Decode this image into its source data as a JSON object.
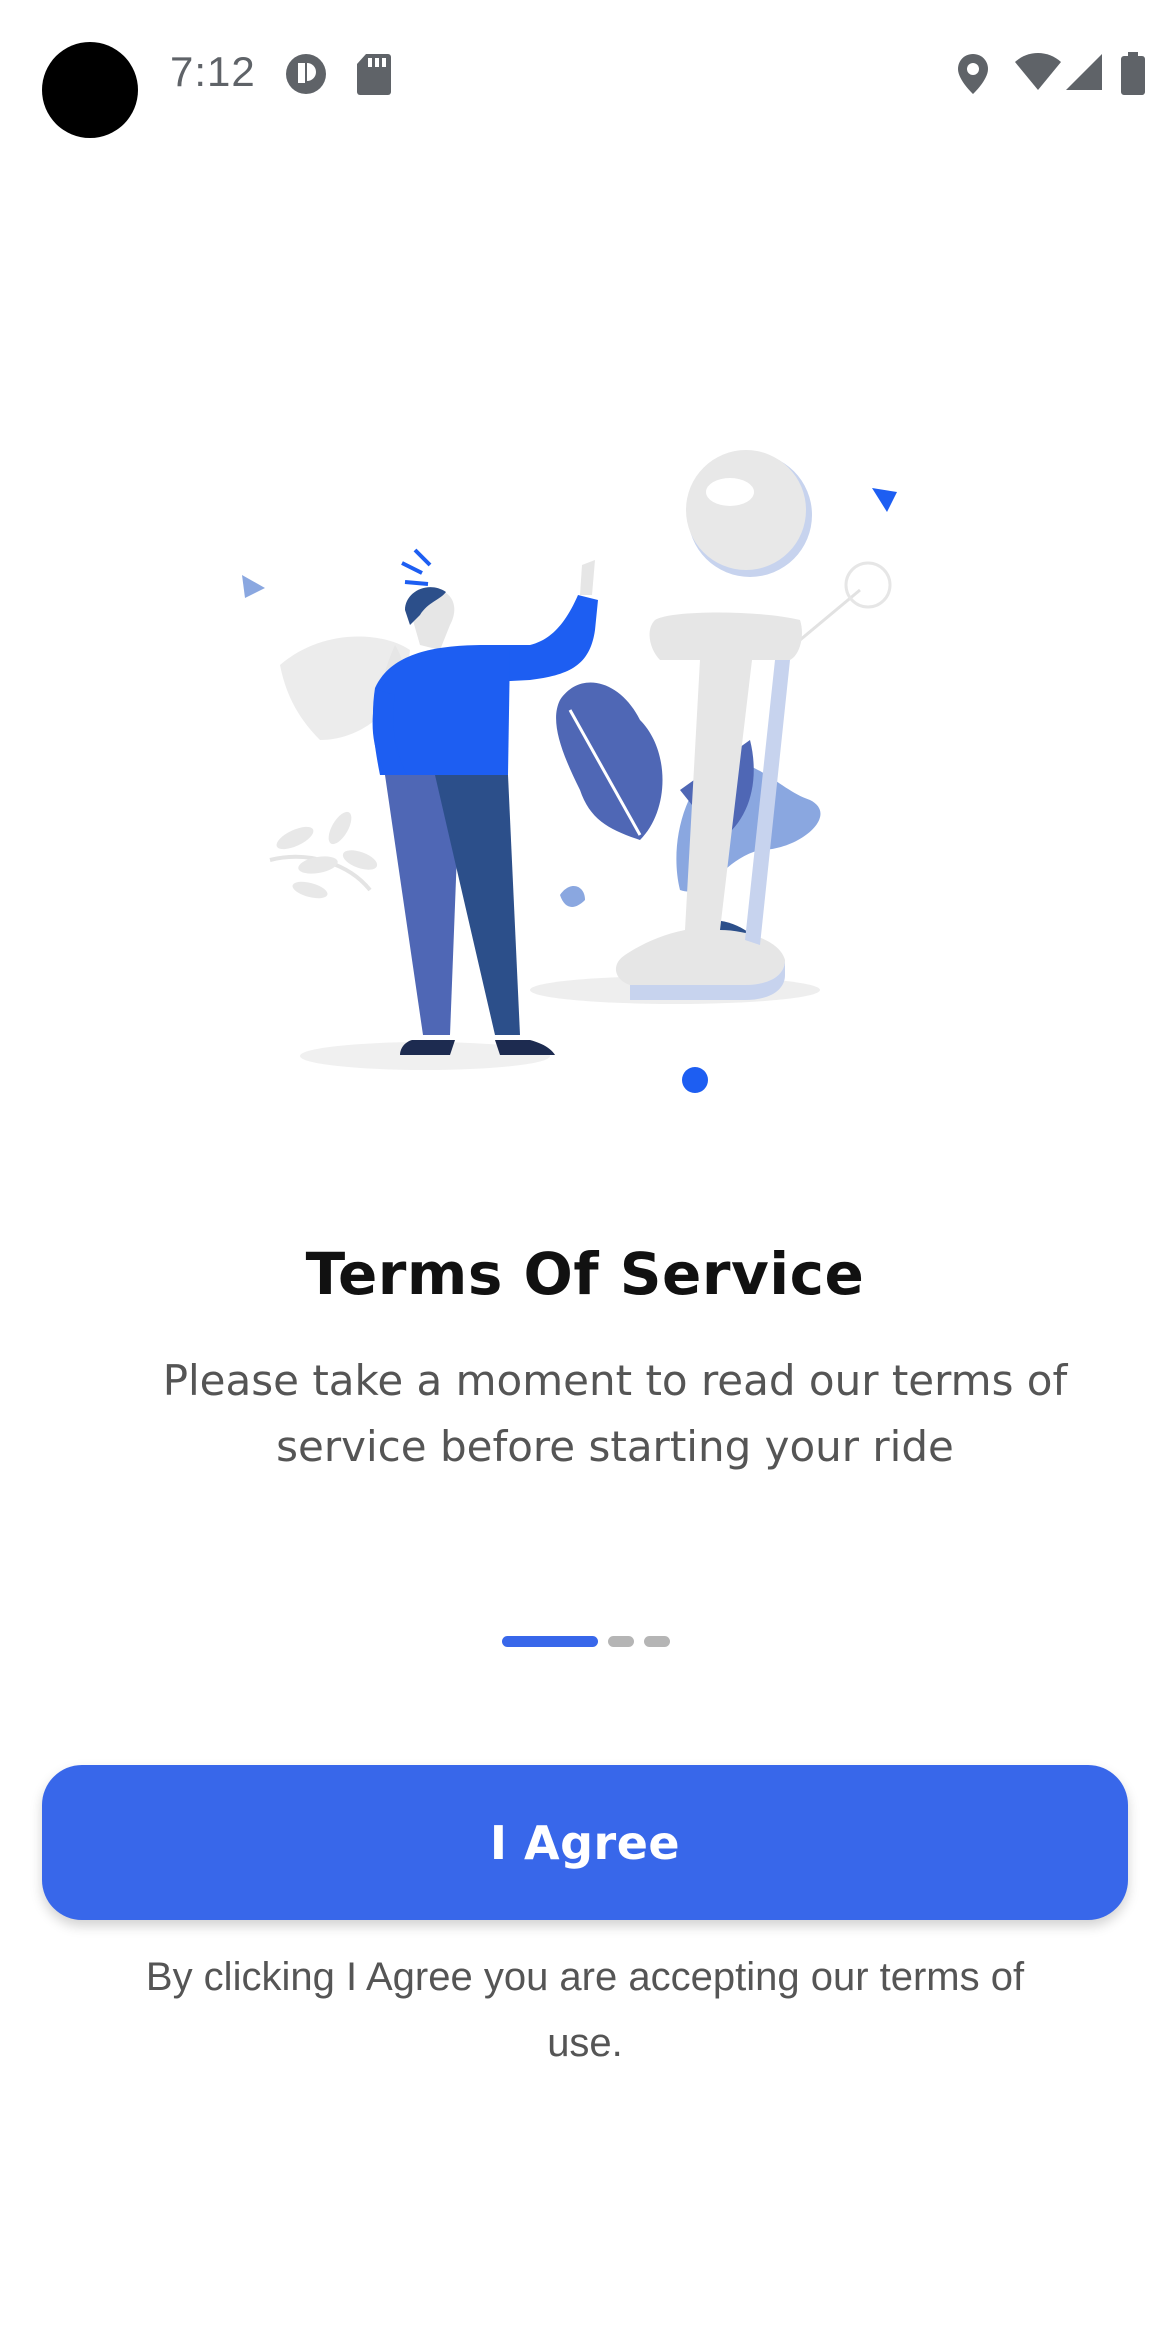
{
  "status_bar": {
    "time": "7:12",
    "icons": [
      "notification-app-icon",
      "sd-card-icon",
      "location-icon",
      "wifi-icon",
      "cell-signal-icon",
      "battery-icon"
    ]
  },
  "illustration": {
    "description_icon": "info-character-illustration",
    "colors": {
      "primary": "#1d5ef2",
      "navy": "#2c4f8a",
      "leaf": "#4f67b5",
      "light_blue": "#8aa7e0",
      "grey": "#e6e6e6"
    }
  },
  "content": {
    "title": "Terms Of Service",
    "subtitle": "Please take a moment to read our terms of service before starting your ride"
  },
  "pager": {
    "pages": 3,
    "active_index": 0
  },
  "actions": {
    "agree_label": "I Agree",
    "footnote": "By clicking I Agree you are accepting our terms of use."
  },
  "colors": {
    "accent": "#3867ea",
    "inactive_dot": "#b5b5b5"
  }
}
